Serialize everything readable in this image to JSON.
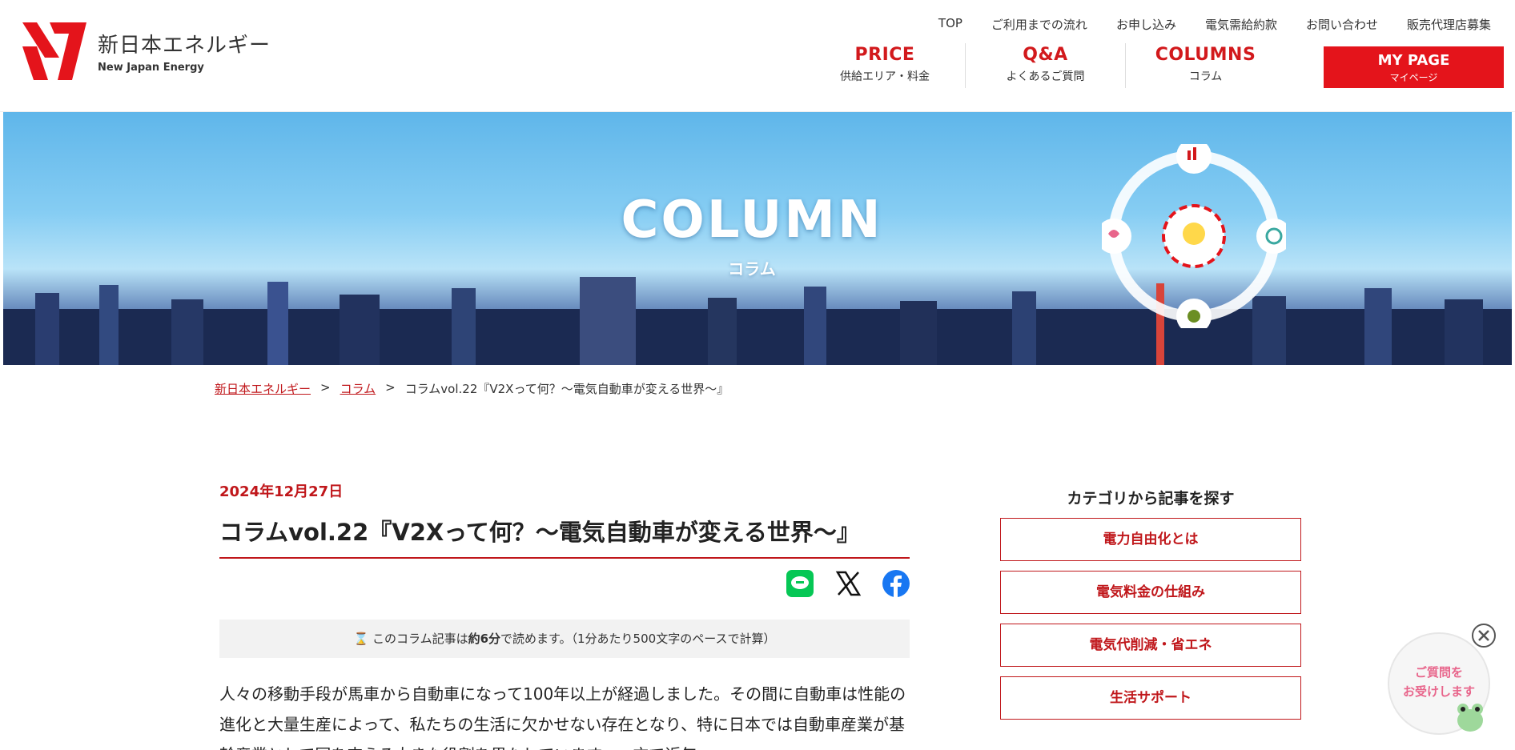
{
  "brand": {
    "name_jp": "新日本エネルギー",
    "name_en": "New Japan Energy",
    "color": "#e4141b"
  },
  "top_nav": [
    "TOP",
    "ご利用までの流れ",
    "お申し込み",
    "電気需給約款",
    "お問い合わせ",
    "販売代理店募集"
  ],
  "main_nav": [
    {
      "en": "PRICE",
      "jp": "供給エリア・料金"
    },
    {
      "en": "Q&A",
      "jp": "よくあるご質問"
    },
    {
      "en": "COLUMNS",
      "jp": "コラム"
    }
  ],
  "mypage": {
    "en": "MY PAGE",
    "jp": "マイページ"
  },
  "hero": {
    "title": "COLUMN",
    "subtitle": "コラム"
  },
  "breadcrumb": {
    "home": "新日本エネルギー",
    "section": "コラム",
    "current": "コラムvol.22『V2Xって何？～電気自動車が変える世界～』",
    "sep": ">"
  },
  "article": {
    "date": "2024年12月27日",
    "title": "コラムvol.22『V2Xって何？～電気自動車が変える世界～』",
    "readtime_pre": "このコラム記事は",
    "readtime_bold": "約6分",
    "readtime_post": "で読めます。（1分あたり500文字のペースで計算）",
    "body": "人々の移動手段が馬車から自動車になって100年以上が経過しました。その間に自動車は性能の進化と大量生産によって、私たちの生活に欠かせない存在となり、特に日本では自動車産業が基幹産業として国を支える大きな役割を果たしています。一方で近年、"
  },
  "sidebar": {
    "title": "カテゴリから記事を探す",
    "categories": [
      "電力自由化とは",
      "電気料金の仕組み",
      "電気代削減・省エネ",
      "生活サポート"
    ]
  },
  "chat": {
    "line1": "ご質問を",
    "line2": "お受けします"
  }
}
